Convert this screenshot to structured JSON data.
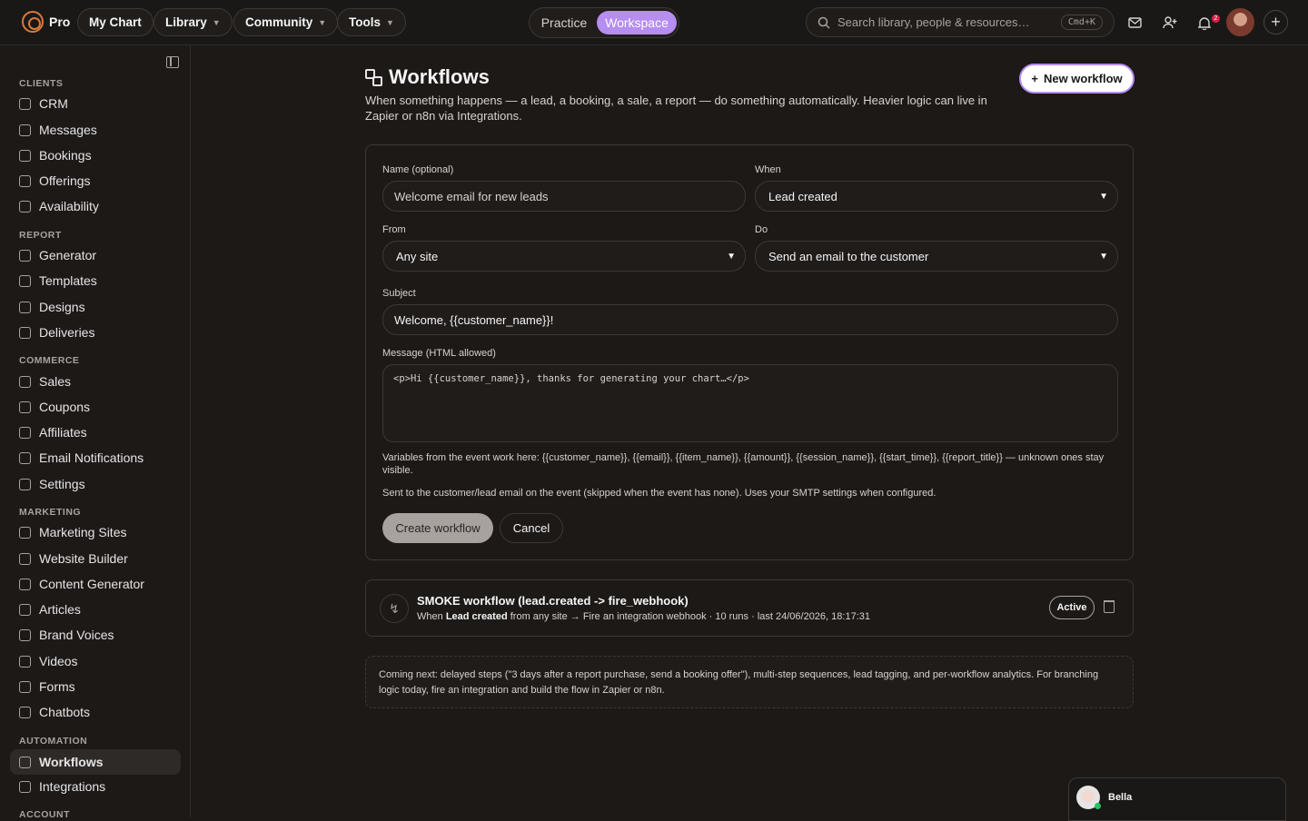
{
  "app": {
    "logo_text": "Pro"
  },
  "nav": {
    "items": [
      {
        "label": "My Chart",
        "has_menu": false
      },
      {
        "label": "Library",
        "has_menu": true
      },
      {
        "label": "Community",
        "has_menu": true
      },
      {
        "label": "Tools",
        "has_menu": true
      }
    ],
    "mode": {
      "practice": "Practice",
      "workspace": "Workspace",
      "selected": "Workspace"
    }
  },
  "search": {
    "placeholder": "Search library, people & resources…",
    "shortcut": "Cmd+K"
  },
  "top_icons": [
    "mail-icon",
    "add-user-icon",
    "bell-icon",
    "plus-icon"
  ],
  "notifications": {
    "count": "2"
  },
  "sidebar": {
    "sections": [
      {
        "title": "CLIENTS",
        "items": [
          "CRM",
          "Messages",
          "Bookings",
          "Offerings",
          "Availability"
        ]
      },
      {
        "title": "REPORT",
        "items": [
          "Generator",
          "Templates",
          "Designs",
          "Deliveries"
        ]
      },
      {
        "title": "COMMERCE",
        "items": [
          "Sales",
          "Coupons",
          "Affiliates",
          "Email Notifications",
          "Settings"
        ]
      },
      {
        "title": "MARKETING",
        "items": [
          "Marketing Sites",
          "Website Builder",
          "Content Generator",
          "Articles",
          "Brand Voices",
          "Videos",
          "Forms",
          "Chatbots"
        ]
      },
      {
        "title": "AUTOMATION",
        "items": [
          "Workflows",
          "Integrations"
        ]
      },
      {
        "title": "ACCOUNT",
        "items": []
      }
    ],
    "active_item": "Workflows"
  },
  "page": {
    "title": "Workflows",
    "description": "When something happens — a lead, a booking, a sale, a report — do something automatically. Heavier logic can live in Zapier or n8n via Integrations.",
    "new_button": "New workflow"
  },
  "form": {
    "name_label": "Name (optional)",
    "name_placeholder": "Welcome email for new leads",
    "when_label": "When",
    "when_value": "Lead created",
    "from_label": "From",
    "from_value": "Any site",
    "do_label": "Do",
    "do_value": "Send an email to the customer",
    "subject_label": "Subject",
    "subject_value": "Welcome, {{customer_name}}!",
    "message_label": "Message (HTML allowed)",
    "message_value": "<p>Hi {{customer_name}}, thanks for generating your chart…</p>",
    "variables_note": "Variables from the event work here: {{customer_name}}, {{email}}, {{item_name}}, {{amount}}, {{session_name}}, {{start_time}}, {{report_title}} — unknown ones stay visible.",
    "send_note": "Sent to the customer/lead email on the event (skipped when the event has none). Uses your SMTP settings when configured.",
    "create_button": "Create workflow",
    "cancel_button": "Cancel"
  },
  "workflows": [
    {
      "name": "SMOKE workflow (lead.created -> fire_webhook)",
      "meta_prefix": "When",
      "meta_trigger": "Lead created",
      "meta_rest": "from any site → Fire an integration webhook · 10 runs · last 24/06/2026, 18:17:31",
      "status": "Active"
    }
  ],
  "coming_next": "Coming next: delayed steps (\"3 days after a report purchase, send a booking offer\"), multi-step sequences, lead tagging, and per-workflow analytics. For branching logic today, fire an integration and build the flow in Zapier or n8n.",
  "chat": {
    "name": "Bella",
    "status": "online"
  },
  "colors": {
    "accent": "#b68df0",
    "brand": "#d97a3a",
    "background": "#1c1917",
    "notification": "#e11d48",
    "online": "#22c55e"
  }
}
